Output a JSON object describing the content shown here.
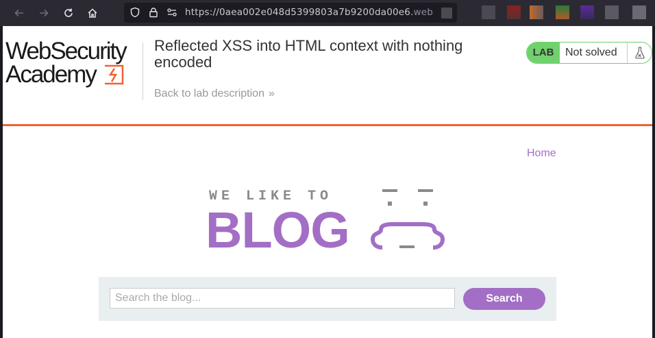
{
  "browser": {
    "url_main": "https://0aea002e048d5399803a7b9200da00e6.",
    "url_dim": "web",
    "nav_buttons": [
      "back-icon",
      "forward-icon",
      "reload-icon",
      "home-icon"
    ],
    "url_icons": [
      "shield-icon",
      "lock-icon",
      "permissions-icon"
    ]
  },
  "header": {
    "logo_line1": "WebSecurity",
    "logo_line2": "Academy",
    "lab_title": "Reflected XSS into HTML context with nothing encoded",
    "back_link": "Back to lab description",
    "back_chevron": "»",
    "badge_label": "LAB",
    "badge_status": "Not solved",
    "colors": {
      "accent_orange": "#f06130",
      "lab_green": "#70d16d"
    }
  },
  "site": {
    "nav_home": "Home",
    "logo_small": "WE LIKE TO",
    "logo_big": "BLOG",
    "brand_purple": "#a36ec5",
    "search_placeholder": "Search the blog...",
    "search_button": "Search"
  }
}
